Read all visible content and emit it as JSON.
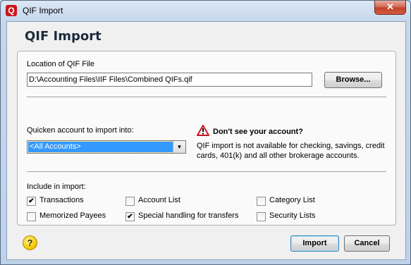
{
  "window": {
    "title": "QIF Import",
    "app_icon_letter": "Q",
    "close_glyph": "✕"
  },
  "heading": "QIF Import",
  "location": {
    "label": "Location of QIF File",
    "path": "D:\\Accounting Files\\IIF Files\\Combined QIFs.qif",
    "browse_label": "Browse..."
  },
  "account": {
    "label": "Quicken account to import into:",
    "selected": "<All Accounts>"
  },
  "warning": {
    "title": "Don't see your account?",
    "text": "QIF import is not available for checking, savings, credit cards, 401(k) and all other brokerage accounts."
  },
  "include": {
    "label": "Include in import:",
    "options": [
      {
        "label": "Transactions",
        "checked": true
      },
      {
        "label": "Account List",
        "checked": false
      },
      {
        "label": "Category List",
        "checked": false
      },
      {
        "label": "Memorized Payees",
        "checked": false
      },
      {
        "label": "Special handling for transfers",
        "checked": true
      },
      {
        "label": "Security Lists",
        "checked": false
      }
    ]
  },
  "buttons": {
    "import": "Import",
    "cancel": "Cancel"
  },
  "help_glyph": "?",
  "colors": {
    "selection": "#3399ff",
    "warning": "#c8161d"
  }
}
